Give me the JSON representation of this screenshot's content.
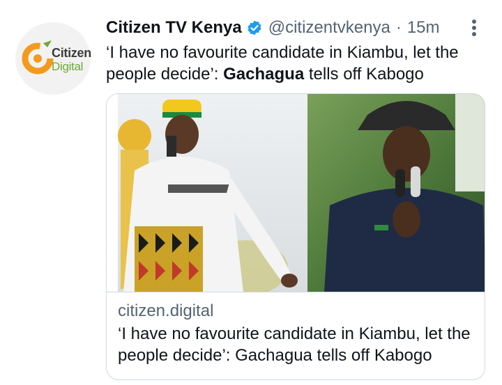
{
  "tweet": {
    "display_name": "Citizen TV Kenya",
    "handle": "@citizentvkenya",
    "separator": "·",
    "time": "15m",
    "verified_icon": "verified-badge-icon",
    "more_icon": "more-options-icon",
    "text_prefix": "‘I have no favourite candidate in Kiambu, let the people decide’: ",
    "text_bold": "Gachagua",
    "text_suffix": " tells off Kabogo"
  },
  "avatar": {
    "logo_word1": "Citizen",
    "logo_word2": "Digital"
  },
  "card": {
    "domain": "citizen.digital",
    "title": "‘I have no favourite candidate in Kiambu, let the people decide’: Gachagua tells off Kabogo"
  },
  "colors": {
    "text": "#0f1419",
    "secondary": "#536471",
    "verified": "#1d9bf0",
    "border": "#cfd9de",
    "logo_orange": "#f39a1e",
    "logo_green": "#6da83a"
  }
}
